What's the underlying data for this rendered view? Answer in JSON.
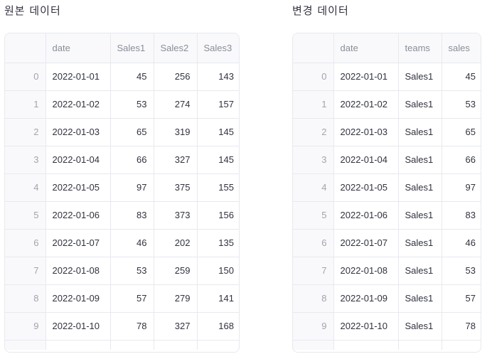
{
  "original": {
    "title": "원본 데이터",
    "columns": [
      "date",
      "Sales1",
      "Sales2",
      "Sales3"
    ],
    "rows": [
      {
        "index": "0",
        "date": "2022-01-01",
        "v1": "45",
        "v2": "256",
        "v3": "143"
      },
      {
        "index": "1",
        "date": "2022-01-02",
        "v1": "53",
        "v2": "274",
        "v3": "157"
      },
      {
        "index": "2",
        "date": "2022-01-03",
        "v1": "65",
        "v2": "319",
        "v3": "145"
      },
      {
        "index": "3",
        "date": "2022-01-04",
        "v1": "66",
        "v2": "327",
        "v3": "145"
      },
      {
        "index": "4",
        "date": "2022-01-05",
        "v1": "97",
        "v2": "375",
        "v3": "155"
      },
      {
        "index": "5",
        "date": "2022-01-06",
        "v1": "83",
        "v2": "373",
        "v3": "156"
      },
      {
        "index": "6",
        "date": "2022-01-07",
        "v1": "46",
        "v2": "202",
        "v3": "135"
      },
      {
        "index": "7",
        "date": "2022-01-08",
        "v1": "53",
        "v2": "259",
        "v3": "150"
      },
      {
        "index": "8",
        "date": "2022-01-09",
        "v1": "57",
        "v2": "279",
        "v3": "141"
      },
      {
        "index": "9",
        "date": "2022-01-10",
        "v1": "78",
        "v2": "327",
        "v3": "168"
      }
    ]
  },
  "transformed": {
    "title": "변경 데이터",
    "columns": [
      "date",
      "teams",
      "sales"
    ],
    "rows": [
      {
        "index": "0",
        "date": "2022-01-01",
        "team": "Sales1",
        "sales": "45"
      },
      {
        "index": "1",
        "date": "2022-01-02",
        "team": "Sales1",
        "sales": "53"
      },
      {
        "index": "2",
        "date": "2022-01-03",
        "team": "Sales1",
        "sales": "65"
      },
      {
        "index": "3",
        "date": "2022-01-04",
        "team": "Sales1",
        "sales": "66"
      },
      {
        "index": "4",
        "date": "2022-01-05",
        "team": "Sales1",
        "sales": "97"
      },
      {
        "index": "5",
        "date": "2022-01-06",
        "team": "Sales1",
        "sales": "83"
      },
      {
        "index": "6",
        "date": "2022-01-07",
        "team": "Sales1",
        "sales": "46"
      },
      {
        "index": "7",
        "date": "2022-01-08",
        "team": "Sales1",
        "sales": "53"
      },
      {
        "index": "8",
        "date": "2022-01-09",
        "team": "Sales1",
        "sales": "57"
      },
      {
        "index": "9",
        "date": "2022-01-10",
        "team": "Sales1",
        "sales": "78"
      }
    ]
  }
}
